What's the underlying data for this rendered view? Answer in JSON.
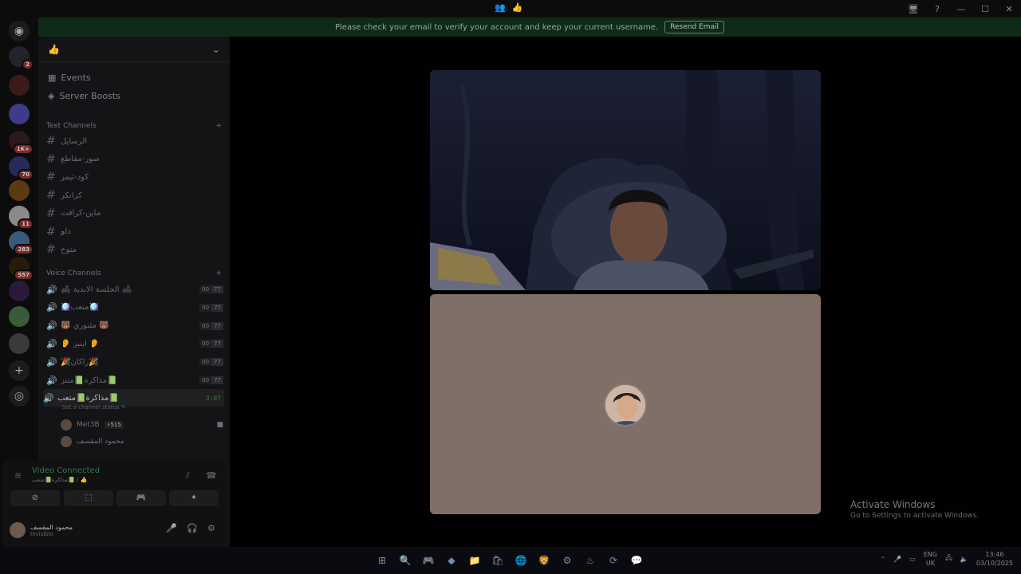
{
  "titlebar": {
    "center_icons": [
      "👥",
      "👍"
    ],
    "buttons": [
      "🖥",
      "?",
      "—",
      "☐",
      "✕"
    ]
  },
  "banner": {
    "message": "Please check your email to verify your account and keep your current username.",
    "button": "Resend Email"
  },
  "guilds": [
    {
      "badge": "2",
      "color": "#22242a"
    },
    {
      "badge": "",
      "color": "#3a1a1a"
    },
    {
      "badge": "",
      "color": "#3d3b8a"
    },
    {
      "badge": "1K+",
      "color": "#2a1a1a"
    },
    {
      "badge": "70",
      "color": "#282a5a"
    },
    {
      "badge": "",
      "color": "#5a3a10"
    },
    {
      "badge": "11",
      "color": "#8a8a8a"
    },
    {
      "badge": "283",
      "color": "#3a5a7a"
    },
    {
      "badge": "557",
      "color": "#2a1a0a"
    },
    {
      "badge": "",
      "color": "#2a1a3a"
    },
    {
      "badge": "",
      "color": "#3a5a3a"
    },
    {
      "badge": "",
      "color": "#3a3a3a"
    }
  ],
  "server": {
    "name": "👍",
    "chevron": "⌄"
  },
  "nav": {
    "events": "Events",
    "boosts": "Server Boosts"
  },
  "text_category": "Text Channels",
  "text_channels": [
    "الرسايل",
    "صور-مقاطع",
    "كود-تيمز",
    "كرانكر",
    "ماين-كرافت",
    "دلو",
    "متوح"
  ],
  "voice_category": "Voice Channels",
  "voice_channels": [
    {
      "name": "🛋 الجلسة الابدية 🛋",
      "a": "00",
      "b": "77"
    },
    {
      "name": "🪩متعب🪩",
      "a": "00",
      "b": "77"
    },
    {
      "name": "🐻 مثنوري 🐻",
      "a": "00",
      "b": "77"
    },
    {
      "name": "👂 اينيز 👂",
      "a": "00",
      "b": "77"
    },
    {
      "name": "🎉راكان🎉",
      "a": "00",
      "b": "77"
    },
    {
      "name": "مذاكرة📗متنز📗",
      "a": "00",
      "b": "77"
    }
  ],
  "active_channel": {
    "name": "مذاكرة📗متعب📗",
    "timer": "3:07",
    "status": "Set a channel status ✎"
  },
  "members": [
    {
      "name": "Met3B",
      "boost": "⚡515"
    },
    {
      "name": "محمود المقسف",
      "boost": ""
    }
  ],
  "voice_panel": {
    "title": "Video Connected",
    "subtitle": "مذاكرة📗متعب📗 / 👍",
    "buttons": [
      "⊘",
      "⬚",
      "🎮",
      "✦"
    ]
  },
  "user": {
    "name": "محمود المقسف",
    "status": "Invisible"
  },
  "watermark": {
    "line1": "Activate Windows",
    "line2": "Go to Settings to activate Windows."
  },
  "taskbar": {
    "icons": [
      "⊞",
      "🔍",
      "🎮",
      "◆",
      "📁",
      "🛍",
      "🌐",
      "🦁",
      "⚙",
      "♨",
      "⟳",
      "💬"
    ],
    "lang1": "ENG",
    "lang2": "UK",
    "time": "13:46",
    "date": "03/10/2025"
  }
}
